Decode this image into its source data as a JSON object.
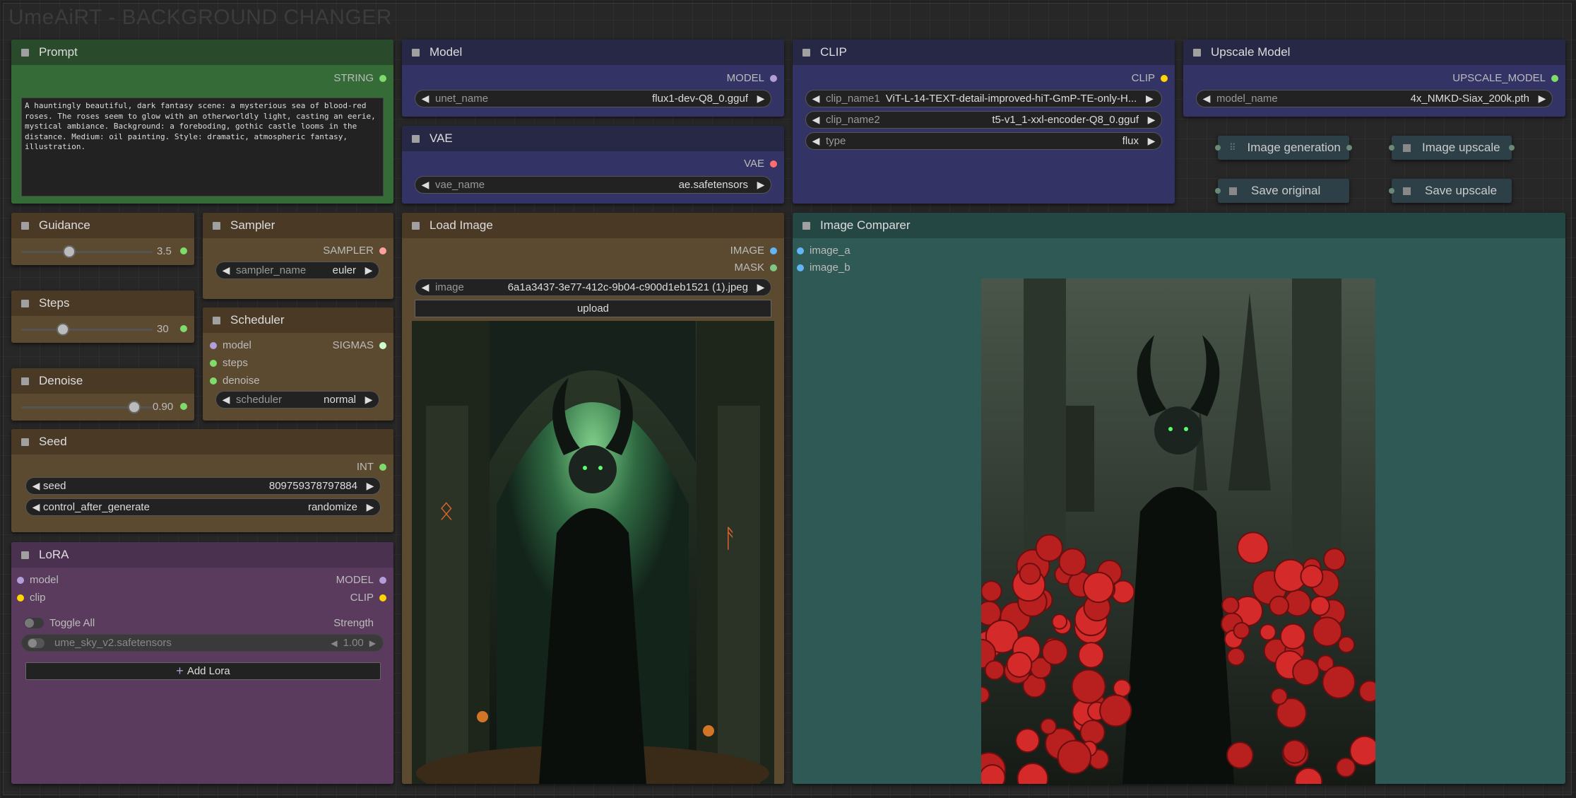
{
  "app": {
    "title": "UmeAiRT - BACKGROUND CHANGER"
  },
  "prompt": {
    "title": "Prompt",
    "output": "STRING",
    "text": "A hauntingly beautiful, dark fantasy scene: a mysterious sea of blood-red roses. The roses seem to glow with an otherworldly light, casting an eerie, mystical ambiance. Background: a foreboding, gothic castle looms in the distance. Medium: oil painting. Style: dramatic, atmospheric fantasy, illustration."
  },
  "model": {
    "title": "Model",
    "output": "MODEL",
    "widget_label": "unet_name",
    "widget_value": "flux1-dev-Q8_0.gguf"
  },
  "vae": {
    "title": "VAE",
    "output": "VAE",
    "widget_label": "vae_name",
    "widget_value": "ae.safetensors"
  },
  "clip": {
    "title": "CLIP",
    "output": "CLIP",
    "widgets": [
      {
        "label": "clip_name1",
        "value": "ViT-L-14-TEXT-detail-improved-hiT-GmP-TE-only-H..."
      },
      {
        "label": "clip_name2",
        "value": "t5-v1_1-xxl-encoder-Q8_0.gguf"
      },
      {
        "label": "type",
        "value": "flux"
      }
    ]
  },
  "upscale_model": {
    "title": "Upscale Model",
    "output": "UPSCALE_MODEL",
    "widget_label": "model_name",
    "widget_value": "4x_NMKD-Siax_200k.pth"
  },
  "buttons": {
    "image_generation": "Image generation",
    "image_upscale": "Image upscale",
    "save_original": "Save original",
    "save_upscale": "Save upscale"
  },
  "guidance": {
    "title": "Guidance",
    "value": "3.5",
    "fraction": 0.35
  },
  "steps": {
    "title": "Steps",
    "value": "30",
    "fraction": 0.3
  },
  "denoise": {
    "title": "Denoise",
    "value": "0.90",
    "fraction": 0.9
  },
  "sampler": {
    "title": "Sampler",
    "output": "SAMPLER",
    "widget_label": "sampler_name",
    "widget_value": "euler"
  },
  "scheduler": {
    "title": "Scheduler",
    "output": "SIGMAS",
    "inputs": [
      "model",
      "steps",
      "denoise"
    ],
    "widget_label": "scheduler",
    "widget_value": "normal"
  },
  "seed": {
    "title": "Seed",
    "output": "INT",
    "seed_label": "seed",
    "seed_value": "809759378797884",
    "cag_label": "control_after_generate",
    "cag_value": "randomize"
  },
  "lora": {
    "title": "LoRA",
    "inputs": [
      "model",
      "clip"
    ],
    "outputs": [
      "MODEL",
      "CLIP"
    ],
    "toggle_all": "Toggle All",
    "strength_label": "Strength",
    "lora_name": "ume_sky_v2.safetensors",
    "lora_strength": "1.00",
    "add_label": "Add Lora"
  },
  "load_image": {
    "title": "Load Image",
    "outputs": [
      "IMAGE",
      "MASK"
    ],
    "widget_label": "image",
    "widget_value": "6a1a3437-3e77-412c-9b04-c900d1eb1521 (1).jpeg",
    "upload_label": "upload"
  },
  "comparer": {
    "title": "Image Comparer",
    "inputs": [
      "image_a",
      "image_b"
    ]
  },
  "colors": {
    "model": "#b39ddb",
    "clip": "#ffd500",
    "vae": "#ff6e6e",
    "image": "#64b5f6",
    "mask": "#81c784",
    "int": "#7fdc6a",
    "float": "#7fdc6a",
    "string": "#7fdc6a",
    "sampler": "#ffa0a0",
    "sigmas": "#cdffcd",
    "upscale": "#7fdc6a"
  }
}
